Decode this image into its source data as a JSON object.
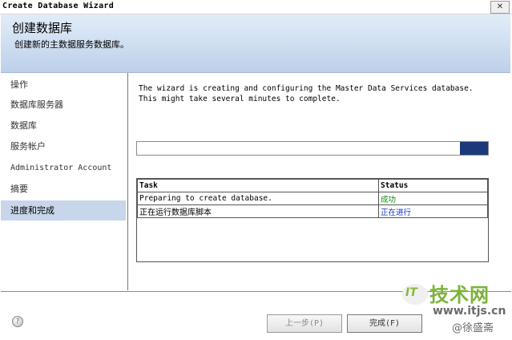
{
  "window": {
    "title": "Create Database Wizard",
    "close_glyph": "✕"
  },
  "header": {
    "title": "创建数据库",
    "subtitle": "创建新的主数据服务数据库。"
  },
  "sidebar": {
    "items": [
      {
        "label": "操作"
      },
      {
        "label": "数据库服务器"
      },
      {
        "label": "数据库"
      },
      {
        "label": "服务帐户"
      },
      {
        "label": "Administrator Account"
      },
      {
        "label": "摘要"
      },
      {
        "label": "进度和完成",
        "active": true
      }
    ]
  },
  "main": {
    "description_line1": "The wizard is creating and configuring the Master Data Services database.",
    "description_line2": "This might take several minutes to complete.",
    "progress_fraction": 0.08,
    "progress_color": "#1b3a7a",
    "table": {
      "headers": [
        "Task",
        "Status"
      ],
      "rows": [
        {
          "task": "Preparing to create database.",
          "status": "成功",
          "status_color": "#0a8a0a"
        },
        {
          "task": "正在运行数据库脚本",
          "status": "正在进行",
          "status_color": "#1030c0"
        }
      ]
    }
  },
  "footer": {
    "help_icon": "help-icon",
    "back_label": "上一步(P)",
    "finish_label": "完成(F)"
  },
  "watermark": {
    "logo_text": "IT",
    "name": "技术网",
    "url": "www.itjs.cn",
    "author": "@徐盛斋"
  }
}
